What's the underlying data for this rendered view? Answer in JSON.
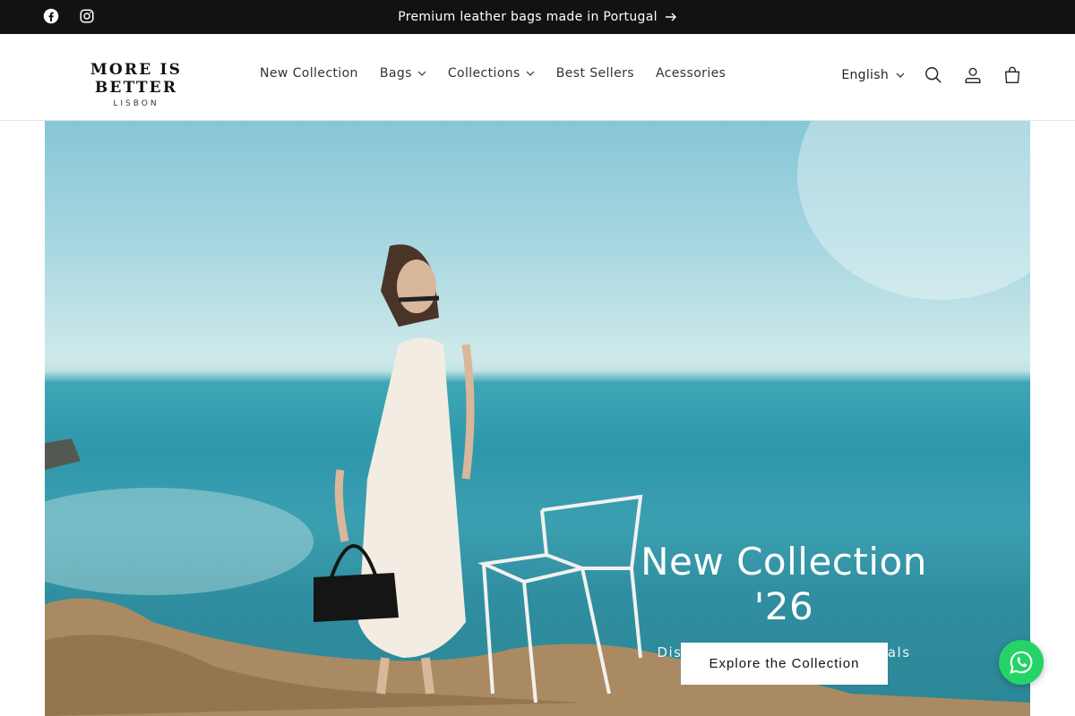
{
  "announcement": {
    "text": "Premium leather bags made in Portugal",
    "social": [
      "facebook-icon",
      "instagram-icon"
    ]
  },
  "brand": {
    "name": "MORE IS BETTER",
    "tagline": "LISBON"
  },
  "nav": {
    "items": [
      {
        "label": "New Collection",
        "dropdown": false
      },
      {
        "label": "Bags",
        "dropdown": true
      },
      {
        "label": "Collections",
        "dropdown": true
      },
      {
        "label": "Best Sellers",
        "dropdown": false
      },
      {
        "label": "Acessories",
        "dropdown": false
      }
    ]
  },
  "header_right": {
    "language": "English",
    "icons": [
      "search-icon",
      "account-icon",
      "cart-icon"
    ]
  },
  "hero": {
    "title": "New Collection '26",
    "subtitle": "Discover our latest bag arrivals",
    "button_label": "Explore the Collection"
  },
  "colors": {
    "announcement_bg": "#121212",
    "button_bg": "#ffffff",
    "whatsapp": "#25d366"
  }
}
